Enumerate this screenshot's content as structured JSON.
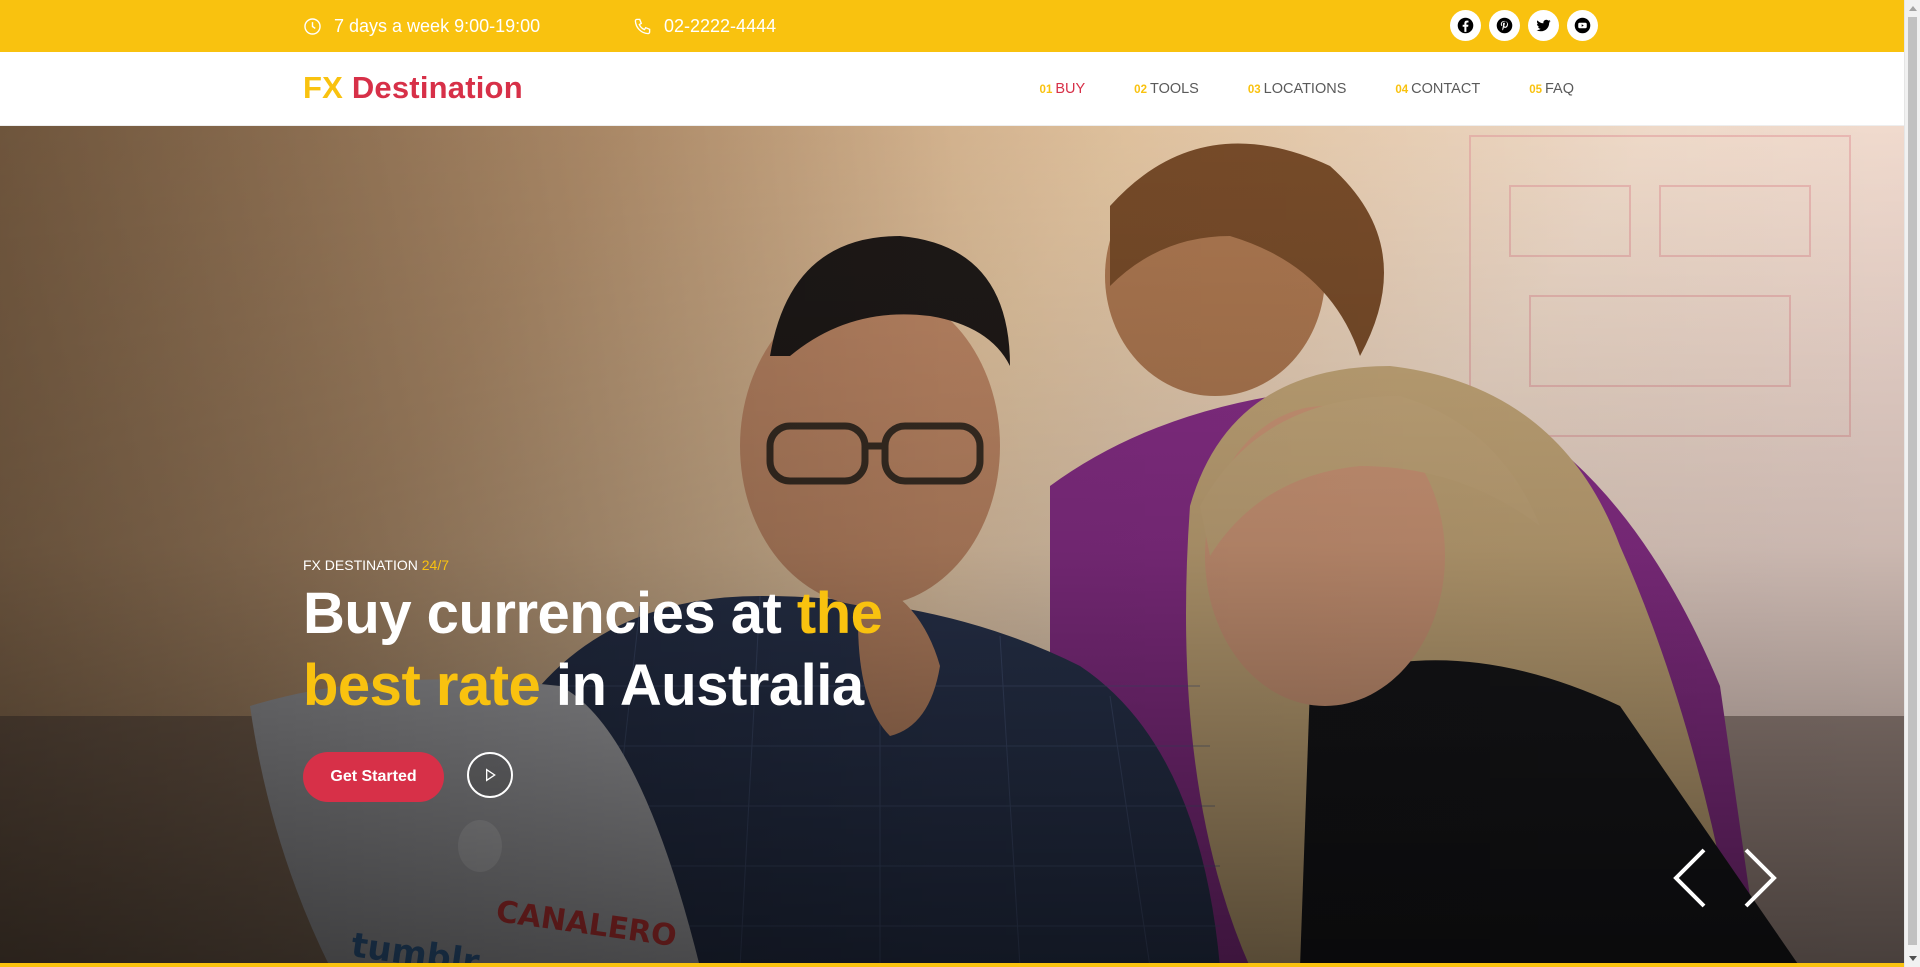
{
  "topbar": {
    "hours": "7 days a week 9:00-19:00",
    "phone": "02-2222-4444",
    "socials": [
      {
        "name": "facebook-icon"
      },
      {
        "name": "pinterest-icon"
      },
      {
        "name": "twitter-icon"
      },
      {
        "name": "youtube-icon"
      }
    ]
  },
  "header": {
    "logo_fx": "FX",
    "logo_destination": "Destination",
    "nav": [
      {
        "num": "01",
        "label": "BUY"
      },
      {
        "num": "02",
        "label": "TOOLS"
      },
      {
        "num": "03",
        "label": "LOCATIONS"
      },
      {
        "num": "04",
        "label": "CONTACT"
      },
      {
        "num": "05",
        "label": "FAQ"
      }
    ]
  },
  "hero": {
    "eyebrow": "FX DESTINATION",
    "eyebrow_highlight": "24/7",
    "headline_part1": "Buy currencies at ",
    "headline_highlight": "the best rate",
    "headline_part2": " in Australia",
    "cta_label": "Get Started"
  },
  "colors": {
    "accent_yellow": "#f9c20f",
    "accent_red": "#d73048"
  }
}
